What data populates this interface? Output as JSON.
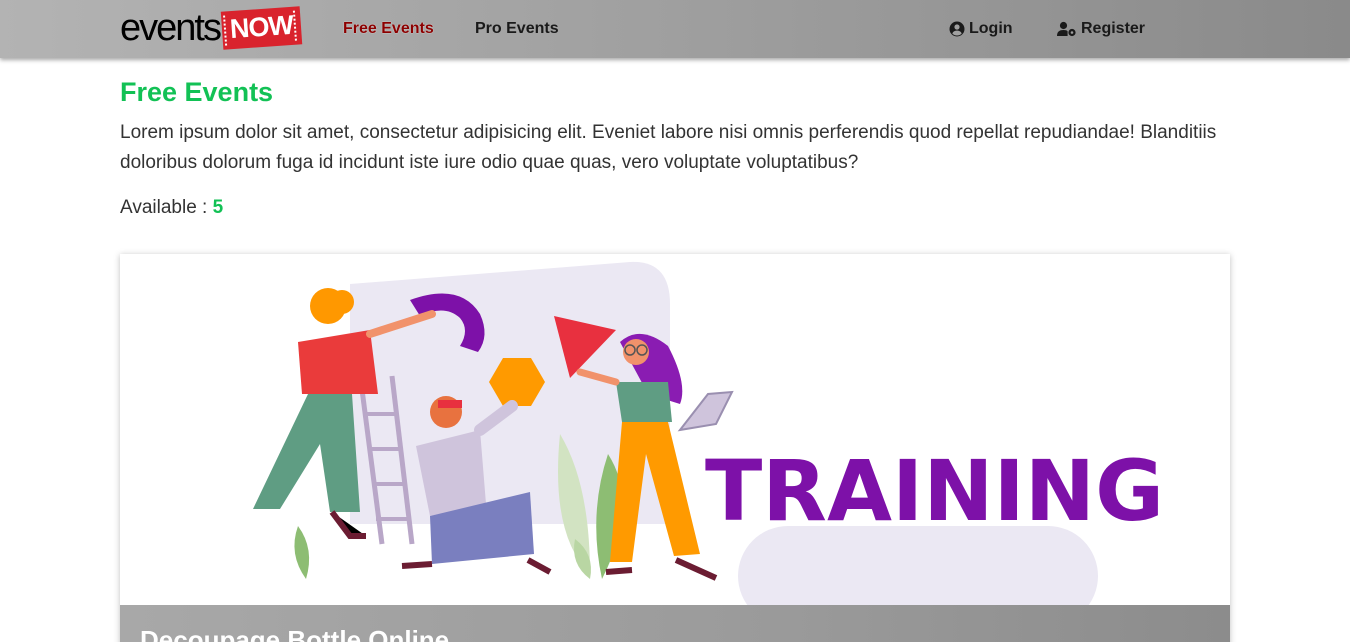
{
  "navbar": {
    "logo_text": "events",
    "logo_badge": "NOW",
    "links": [
      {
        "label": "Free Events",
        "active": true
      },
      {
        "label": "Pro Events",
        "active": false
      }
    ],
    "login_label": "Login",
    "register_label": "Register",
    "login_icon": "user-circle-icon",
    "register_icon": "user-cog-icon"
  },
  "main": {
    "title": "Free Events",
    "description": "Lorem ipsum dolor sit amet, consectetur adipisicing elit. Eveniet labore nisi omnis perferendis quod repellat repudiandae! Blanditiis doloribus dolorum fuga id incidunt iste iure odio quae quas, vero voluptate voluptatibus?",
    "available_label": "Available : ",
    "available_count": "5"
  },
  "event_card": {
    "image_text": "TRAINING",
    "title": "Decoupage Bottle Online"
  },
  "colors": {
    "accent_green": "#12c155",
    "active_link": "#8b0000",
    "logo_red": "#d9232d",
    "training_purple": "#7d11a8"
  }
}
